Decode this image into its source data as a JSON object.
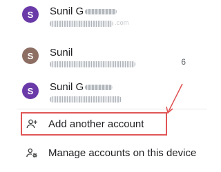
{
  "accounts": [
    {
      "initial": "S",
      "name": "Sunil G",
      "email_tail": ".com",
      "avatar_color": "#6a3aa8",
      "badge": ""
    },
    {
      "initial": "S",
      "name": "Sunil",
      "email_tail": "",
      "avatar_color": "#8d6e63",
      "badge": "6"
    },
    {
      "initial": "S",
      "name": "Sunil G",
      "email_tail": "",
      "avatar_color": "#6a3aa8",
      "badge": ""
    }
  ],
  "actions": {
    "add_account": "Add another account",
    "manage_accounts": "Manage accounts on this device"
  },
  "icons": {
    "add_account": "person-add-icon",
    "manage_accounts": "manage-accounts-icon"
  },
  "highlight_color": "#e05555"
}
